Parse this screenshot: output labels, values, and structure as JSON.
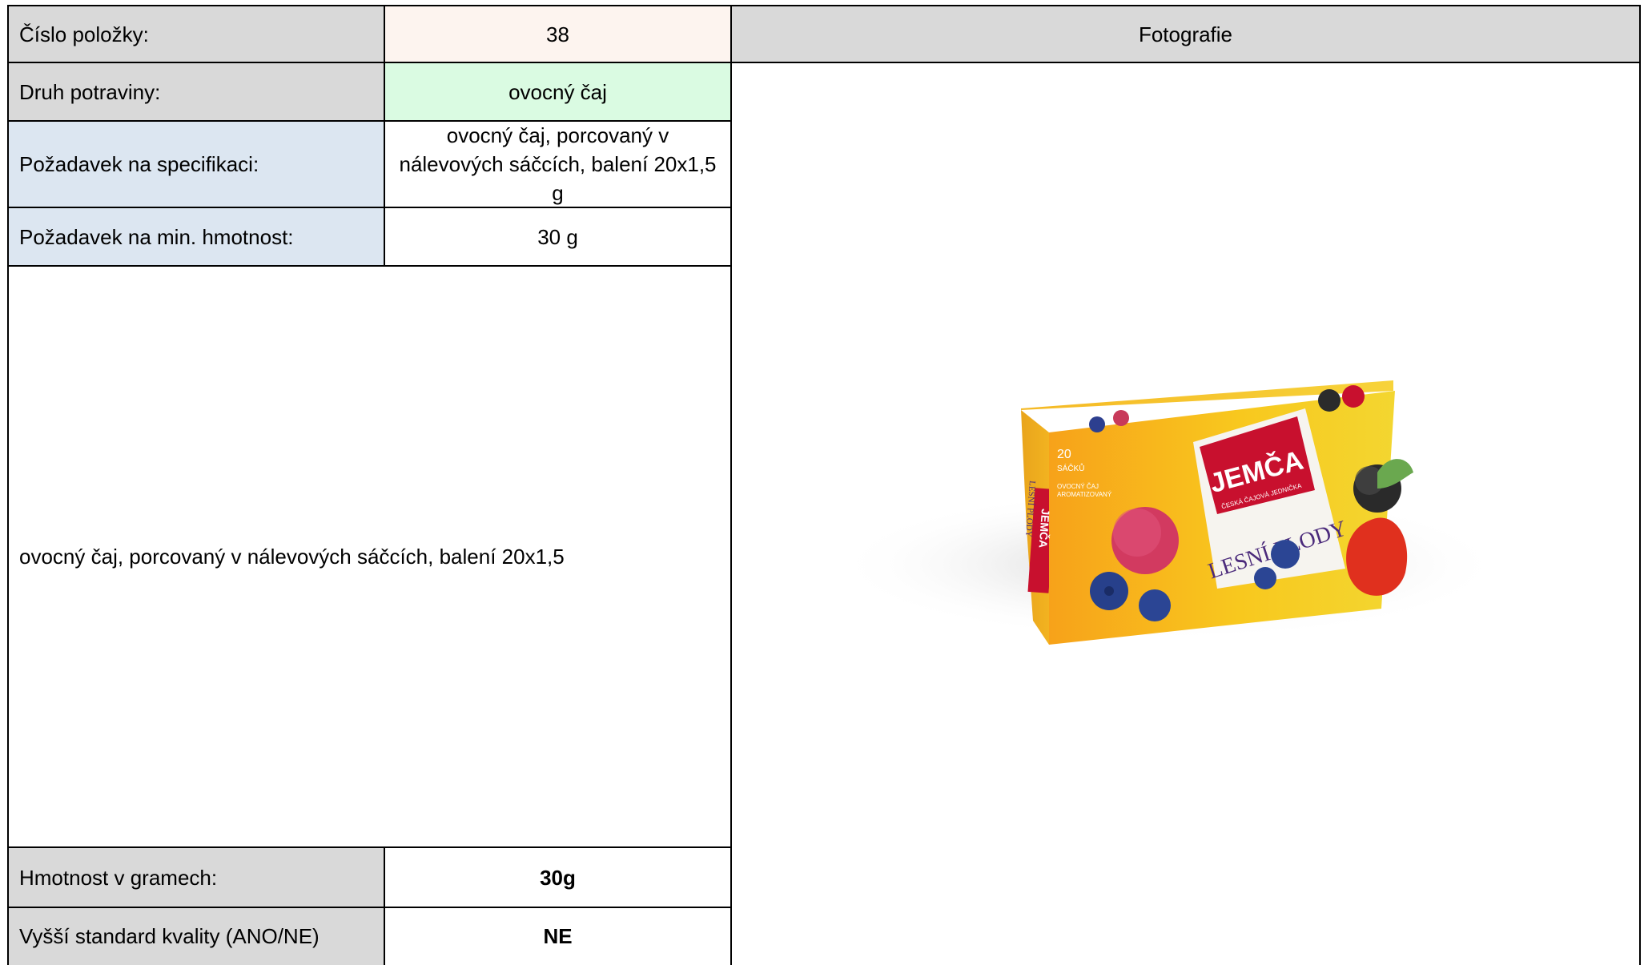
{
  "table": {
    "item_number_label": "Číslo položky:",
    "item_number_value": "38",
    "photo_header": "Fotografie",
    "food_type_label": "Druh potraviny:",
    "food_type_value": "ovocný čaj",
    "spec_label": "Požadavek na specifikaci:",
    "spec_value_line1": "ovocný čaj, porcovaný v",
    "spec_value_line2": "nálevových sáčcích, balení 20x1,5",
    "spec_value_line3": "g",
    "min_weight_label": "Požadavek na min. hmotnost:",
    "min_weight_value": "30 g",
    "description": "ovocný čaj, porcovaný v nálevových sáčcích, balení 20x1,5",
    "weight_grams_label": "Hmotnost v gramech:",
    "weight_grams_value": "30g",
    "quality_label": "Vyšší standard kvality (ANO/NE)",
    "quality_value": "NE"
  },
  "product_box": {
    "brand": "JEMČA",
    "brand_tagline": "ČESKÁ ČAJOVÁ JEDNIČKA",
    "flavor": "LESNÍ PLODY",
    "count": "20",
    "count_unit": "SÁČKŮ",
    "subtitle_line1": "OVOCNÝ ČAJ",
    "subtitle_line2": "AROMATIZOVANÝ",
    "side_brand": "JEMČA",
    "side_flavor": "LESNÍ PLODY"
  },
  "colors": {
    "header_gray": "#d9d9d9",
    "label_blue": "#dce6f1",
    "value_peach": "#fdf4ef",
    "value_green": "#dafbe2",
    "brand_red": "#c8102e",
    "box_yellow": "#f5c21b",
    "flavor_purple": "#4b2a7b"
  }
}
